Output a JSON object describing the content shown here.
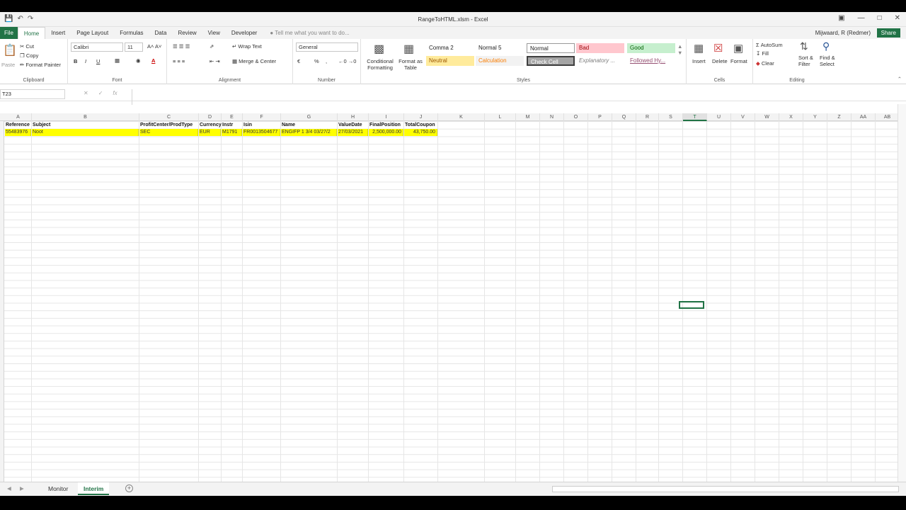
{
  "window": {
    "title": "RangeToHTML.xlsm - Excel",
    "user": "Mijwaard, R (Redmer)",
    "share": "Share"
  },
  "tabs": [
    "File",
    "Home",
    "Insert",
    "Page Layout",
    "Formulas",
    "Data",
    "Review",
    "View",
    "Developer"
  ],
  "tellme": "Tell me what you want to do...",
  "ribbon": {
    "clipboard": {
      "label": "Clipboard",
      "paste": "Paste",
      "cut": "Cut",
      "copy": "Copy",
      "format_painter": "Format Painter"
    },
    "font": {
      "label": "Font",
      "name": "Calibri",
      "size": "11"
    },
    "alignment": {
      "label": "Alignment",
      "wrap": "Wrap Text",
      "merge": "Merge & Center"
    },
    "number": {
      "label": "Number",
      "format": "General"
    },
    "cond_format": "Conditional Formatting",
    "format_table": "Format as Table",
    "styles": {
      "label": "Styles",
      "items": [
        {
          "name": "Comma 2",
          "bg": "#ffffff",
          "fg": "#222222"
        },
        {
          "name": "Normal 5",
          "bg": "#ffffff",
          "fg": "#222222"
        },
        {
          "name": "Normal",
          "bg": "#ffffff",
          "fg": "#222222"
        },
        {
          "name": "Bad",
          "bg": "#ffc7ce",
          "fg": "#9c0006"
        },
        {
          "name": "Good",
          "bg": "#c6efce",
          "fg": "#006100"
        },
        {
          "name": "Neutral",
          "bg": "#ffeb9c",
          "fg": "#9c5700"
        },
        {
          "name": "Calculation",
          "bg": "#f2f2f2",
          "fg": "#fa7d00"
        },
        {
          "name": "Check Cell",
          "bg": "#a5a5a5",
          "fg": "#ffffff"
        },
        {
          "name": "Explanatory ...",
          "bg": "#ffffff",
          "fg": "#7f7f7f"
        },
        {
          "name": "Followed Hy...",
          "bg": "#ffffff",
          "fg": "#954f72"
        }
      ]
    },
    "cells": {
      "label": "Cells",
      "insert": "Insert",
      "delete": "Delete",
      "format": "Format"
    },
    "editing": {
      "label": "Editing",
      "autosum": "AutoSum",
      "fill": "Fill",
      "clear": "Clear",
      "sort": "Sort & Filter",
      "find": "Find & Select"
    }
  },
  "formula_bar": {
    "name_box": "T23",
    "value": ""
  },
  "columns": [
    "A",
    "B",
    "C",
    "D",
    "E",
    "F",
    "G",
    "H",
    "I",
    "J",
    "K",
    "L",
    "M",
    "N",
    "O",
    "P",
    "Q",
    "R",
    "S",
    "T",
    "U",
    "V",
    "W",
    "X",
    "Y",
    "Z",
    "AA",
    "AB"
  ],
  "selected_column": "T",
  "table": {
    "headers": [
      "Reference",
      "Subject",
      "ProfitCenter/ProdType",
      "Currency",
      "Instr",
      "Isin",
      "Name",
      "ValueDate",
      "FinalPosition",
      "TotalCoupon"
    ],
    "row": [
      "55483976",
      "Noot",
      "SEC",
      "EUR",
      "M1791",
      "FR0013504677",
      "ENGIFP 1 3/4 03/27/2",
      "27/03/2021",
      "2,500,000.00",
      "43,750.00"
    ],
    "highlight_color": "#ffff00"
  },
  "sheets": [
    {
      "name": "Monitor",
      "active": false
    },
    {
      "name": "Interim",
      "active": true
    }
  ]
}
